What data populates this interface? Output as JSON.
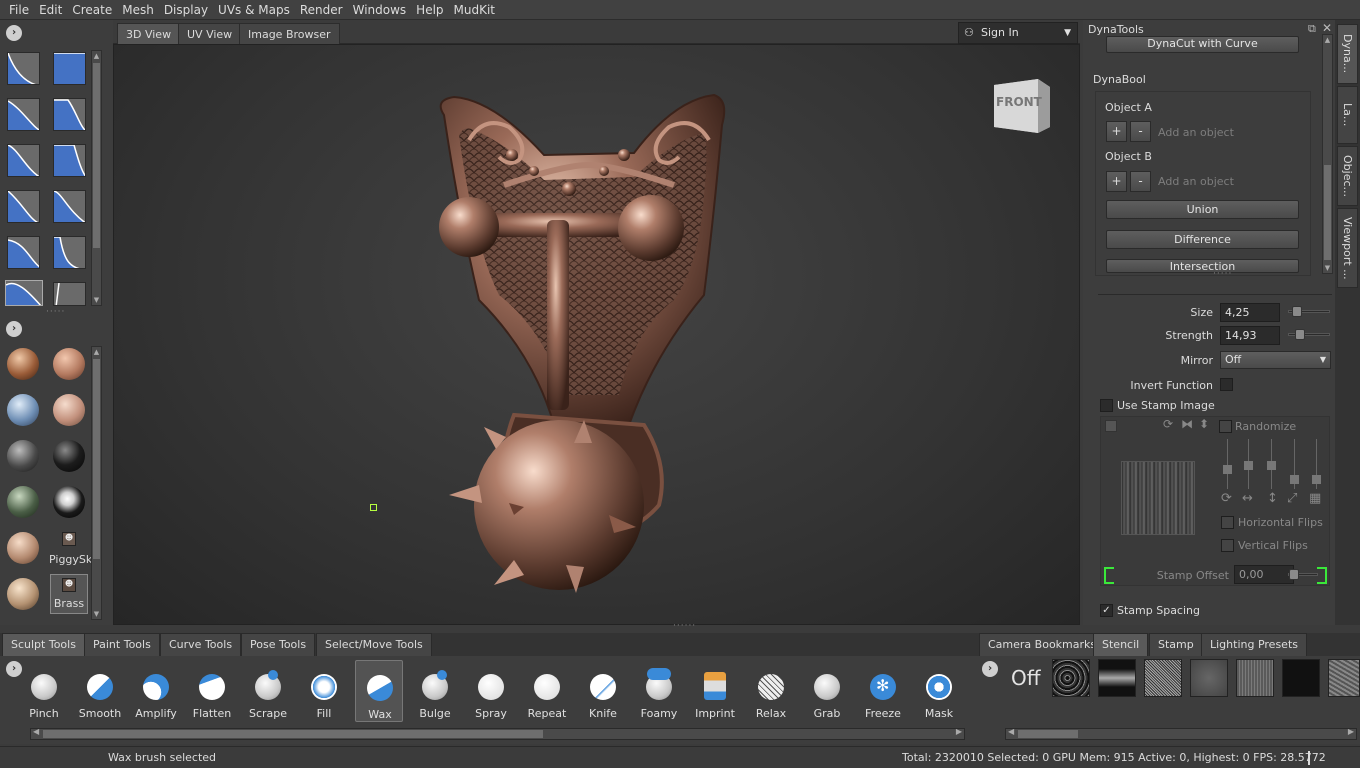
{
  "menu": [
    "File",
    "Edit",
    "Create",
    "Mesh",
    "Display",
    "UVs & Maps",
    "Render",
    "Windows",
    "Help",
    "MudKit"
  ],
  "viewport_tabs": [
    "3D View",
    "UV View",
    "Image Browser"
  ],
  "signin": {
    "label": "Sign In"
  },
  "materials": {
    "label_piggy": "PiggySkin",
    "label_brass": "Brass"
  },
  "view_cube": {
    "label": "FRONT"
  },
  "dynatools": {
    "title": "DynaTools",
    "dynacut_btn": "DynaCut with Curve",
    "dynabool_label": "DynaBool",
    "object_a_label": "Object A",
    "object_b_label": "Object B",
    "add_btn": "+",
    "remove_btn": "-",
    "add_object_placeholder": "Add an object",
    "union_btn": "Union",
    "difference_btn": "Difference",
    "intersection_btn": "Intersection"
  },
  "right_tabs": [
    "Dyna...",
    "La...",
    "Objec...",
    "Viewport ..."
  ],
  "brush_props": {
    "size_label": "Size",
    "size_value": "4,25",
    "size_level": 0.08,
    "strength_label": "Strength",
    "strength_value": "14,93",
    "strength_level": 0.15,
    "mirror_label": "Mirror",
    "mirror_value": "Off",
    "invert_label": "Invert Function",
    "use_stamp_label": "Use Stamp Image",
    "randomize_label": "Randomize",
    "hflips_label": "Horizontal Flips",
    "vflips_label": "Vertical Flips",
    "stamp_offset_label": "Stamp Offset",
    "stamp_offset_value": "0,00",
    "stamp_spacing_label": "Stamp Spacing",
    "stamp_spacing_checked": "✓"
  },
  "bottom_tabs_left": [
    "Sculpt Tools",
    "Paint Tools",
    "Curve Tools",
    "Pose Tools",
    "Select/Move Tools"
  ],
  "bottom_tabs_right": [
    "Camera Bookmarks",
    "Stencil",
    "Stamp",
    "Lighting Presets"
  ],
  "tools": [
    "Pinch",
    "Smooth",
    "Amplify",
    "Flatten",
    "Scrape",
    "Fill",
    "Wax",
    "Bulge",
    "Spray",
    "Repeat",
    "Knife",
    "Foamy",
    "Imprint",
    "Relax",
    "Grab",
    "Freeze",
    "Mask"
  ],
  "active_tool": "Wax",
  "stencil_off": "Off",
  "status": {
    "left": "Wax brush selected",
    "right": "Total: 2320010  Selected: 0 GPU Mem: 915  Active: 0, Highest: 0  FPS: 28.5772"
  },
  "colors": {
    "accent": "#3a8ad8",
    "curve_fill": "#4472c4",
    "marker": "#b6ff40"
  }
}
